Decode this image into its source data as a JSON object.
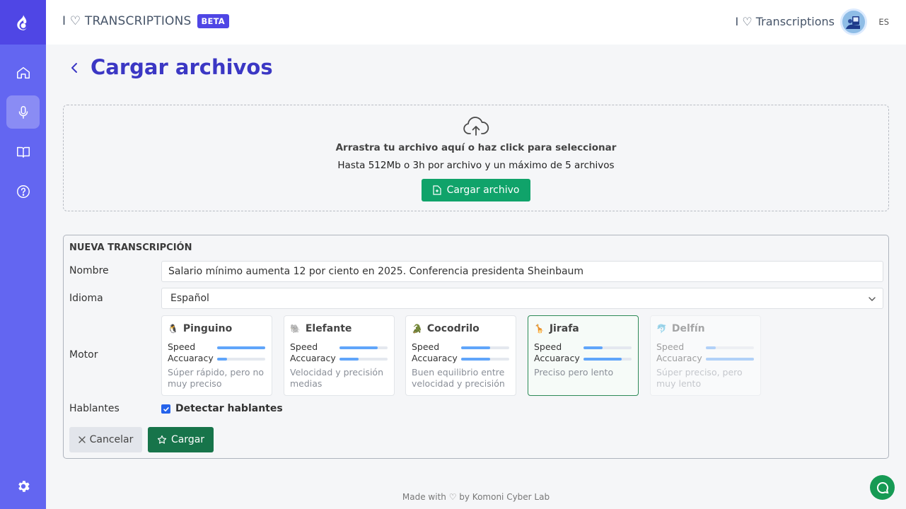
{
  "header": {
    "brand": "I ♡ TRANSCRIPTIONS",
    "badge": "BETA",
    "user_name": "I ♡ Transcriptions",
    "language": "ES"
  },
  "sidebar": {
    "items": [
      {
        "icon": "home-icon"
      },
      {
        "icon": "microphone-icon",
        "active": true
      },
      {
        "icon": "book-icon"
      },
      {
        "icon": "help-icon"
      },
      {
        "icon": "settings-icon"
      }
    ]
  },
  "page": {
    "title": "Cargar archivos"
  },
  "dropzone": {
    "title": "Arrastra tu archivo aquí o haz click para seleccionar",
    "subtitle": "Hasta 512Mb o 3h por archivo y un máximo de 5 archivos",
    "button": "Cargar archivo"
  },
  "form": {
    "section_title": "NUEVA TRANSCRIPCIÓN",
    "name_label": "Nombre",
    "name_value": "Salario mínimo aumenta 12 por ciento en 2025. Conferencia presidenta Sheinbaum",
    "language_label": "Idioma",
    "language_value": "Español",
    "engine_label": "Motor",
    "speakers_label": "Hablantes",
    "speakers_checkbox": "Detectar hablantes",
    "speakers_checked": true,
    "cancel": "Cancelar",
    "submit": "Cargar"
  },
  "engines": [
    {
      "icon": "🐧",
      "name": "Pinguino",
      "speed_label": "Speed",
      "accuracy_label": "Accuaracy",
      "speed": 1.0,
      "accuracy": 0.2,
      "desc": "Súper rápido, pero no muy preciso",
      "state": "normal"
    },
    {
      "icon": "🐘",
      "name": "Elefante",
      "speed_label": "Speed",
      "accuracy_label": "Accuaracy",
      "speed": 0.8,
      "accuracy": 0.4,
      "desc": "Velocidad y precisión medias",
      "state": "normal"
    },
    {
      "icon": "🐊",
      "name": "Cocodrilo",
      "speed_label": "Speed",
      "accuracy_label": "Accuaracy",
      "speed": 0.6,
      "accuracy": 0.6,
      "desc": "Buen equilibrio entre velocidad y precisión",
      "state": "normal"
    },
    {
      "icon": "🦒",
      "name": "Jirafa",
      "speed_label": "Speed",
      "accuracy_label": "Accuaracy",
      "speed": 0.4,
      "accuracy": 0.8,
      "desc": "Preciso pero lento",
      "state": "selected"
    },
    {
      "icon": "🐬",
      "name": "Delfín",
      "speed_label": "Speed",
      "accuracy_label": "Accuaracy",
      "speed": 0.2,
      "accuracy": 1.0,
      "desc": "Súper preciso, pero muy lento",
      "state": "disabled"
    }
  ],
  "footer": {
    "text": "Made with ♡ by Komoni Cyber Lab"
  },
  "colors": {
    "sidebar": "#6366f1",
    "primary": "#4f46e5",
    "title": "#3b37c4",
    "success": "#10a36a",
    "submit": "#17744a"
  }
}
